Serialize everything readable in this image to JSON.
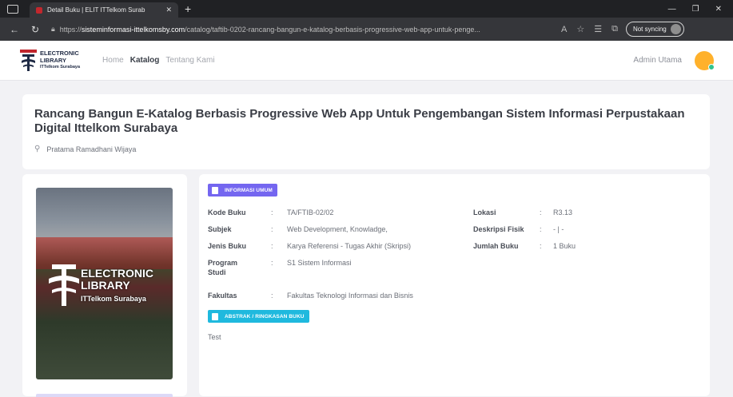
{
  "browser": {
    "tab_title": "Detail Buku | ELIT ITTelkom Surab",
    "url_prefix": "https://",
    "url_host": "sisteminformasi-ittelkomsby.com",
    "url_path": "/catalog/taftib-0202-rancang-bangun-e-katalog-berbasis-progressive-web-app-untuk-penge...",
    "sync_label": "Not syncing"
  },
  "header": {
    "logo_line1": "ELECTRONIC",
    "logo_line2": "LIBRARY",
    "logo_line3": "ITTelkom Surabaya",
    "nav": [
      "Home",
      "Katalog",
      "Tentang Kami"
    ],
    "user_name": "Admin Utama"
  },
  "book": {
    "title": "Rancang Bangun E-Katalog Berbasis Progressive Web App Untuk Pengembangan Sistem Informasi Perpustakaan Digital Ittelkom Surabaya",
    "author": "Pratama Ramadhani Wijaya"
  },
  "cover": {
    "line1": "ELECTRONIC",
    "line2": "LIBRARY",
    "line3": "ITTelkom Surabaya"
  },
  "info": {
    "badge_general": "INFORMASI UMUM",
    "badge_abstract": "ABSTRAK / RINGKASAN BUKU",
    "separator": ":",
    "fields_left": [
      {
        "label": "Kode Buku",
        "value": "TA/FTIB-02/02"
      },
      {
        "label": "Subjek",
        "value": "Web Development, Knowladge,"
      },
      {
        "label": "Jenis Buku",
        "value": "Karya Referensi - Tugas Akhir (Skripsi)"
      },
      {
        "label": "Program Studi",
        "value": "S1 Sistem Informasi"
      },
      {
        "label": "Fakultas",
        "value": "Fakultas Teknologi Informasi dan Bisnis"
      }
    ],
    "fields_right": [
      {
        "label": "Lokasi",
        "value": "R3.13"
      },
      {
        "label": "Deskripsi Fisik",
        "value": "- | -"
      },
      {
        "label": "Jumlah Buku",
        "value": "1 Buku"
      }
    ],
    "abstract_text": "Test"
  }
}
